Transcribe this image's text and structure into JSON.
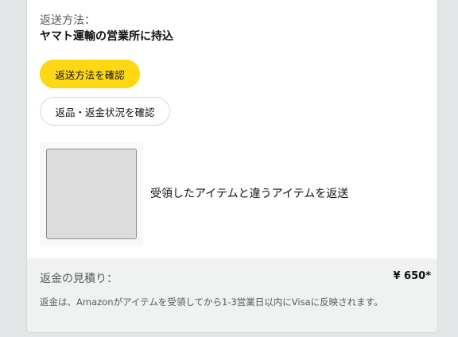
{
  "return_method": {
    "label": "返送方法：",
    "value": "ヤマト運輸の営業所に持込"
  },
  "buttons": {
    "confirm_method": "返送方法を確認",
    "check_status": "返品・返金状況を確認"
  },
  "item": {
    "reason": "受領したアイテムと違うアイテムを返送"
  },
  "refund": {
    "label": "返金の見積り：",
    "amount": "¥ 650*",
    "note": "返金は、Amazonがアイテムを受領してから1-3営業日以内にVisaに反映されます。"
  },
  "colors": {
    "primary_button": "#ffd814",
    "background": "#e3e6e6",
    "refund_panel": "#f0f2f2"
  }
}
